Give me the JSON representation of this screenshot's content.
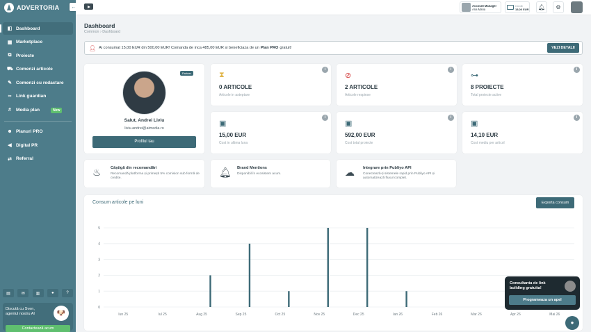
{
  "brand": {
    "name": "ADVERTORIA"
  },
  "sidebar": {
    "collapse_icon": "arrow-left-icon",
    "items": [
      {
        "label": "Dashboard",
        "icon": "dashboard-icon",
        "active": true
      },
      {
        "label": "Marketplace",
        "icon": "store-icon"
      },
      {
        "label": "Proiecte",
        "icon": "projects-icon"
      },
      {
        "label": "Comenzi articole",
        "icon": "cart-icon"
      },
      {
        "label": "Comenzi cu redactare",
        "icon": "edit-cart-icon"
      },
      {
        "label": "Link guardian",
        "icon": "link-icon"
      },
      {
        "label": "Media plan",
        "icon": "hash-icon",
        "badge": "New"
      },
      {
        "label": "Planuri PRO",
        "icon": "users-icon"
      },
      {
        "label": "Digital PR",
        "icon": "megaphone-icon"
      },
      {
        "label": "Referral",
        "icon": "handshake-icon"
      }
    ],
    "assistant": {
      "text": "Discută cu Sven, agentul nostru AI",
      "button": "Contactează acum"
    }
  },
  "topbar": {
    "manager_title": "Account Manager",
    "manager_name": "Ana Maria",
    "credit_label": "Credit",
    "credit_value": "15,00 EUR"
  },
  "page": {
    "title": "Dashboard",
    "breadcrumb": "Common  ›  Dashboard"
  },
  "alert": {
    "pre": "Ai consumat 15,00 EUR din 500,00 EUR! Comanda de inca 485,00 EUR si beneficiaza de un",
    "bold": "Plan PRO",
    "post": "gratuit!",
    "button": "VEZI DETALII"
  },
  "profile": {
    "badge": "Partner",
    "greeting": "Salut, Andrei Liviu",
    "email": "liviu.andrei@aimedia.ro",
    "button": "Profilul tau"
  },
  "stats": [
    {
      "icon": "hourglass-icon",
      "value": "0 ARTICOLE",
      "label": "Articole in asteptare",
      "color": "#e0b54b"
    },
    {
      "icon": "ban-icon",
      "value": "2 ARTICOLE",
      "label": "Articole respinse",
      "color": "#d33a3a"
    },
    {
      "icon": "project-diagram-icon",
      "value": "8 PROIECTE",
      "label": "Total proiecte active",
      "color": "#3d6a77"
    },
    {
      "icon": "money-icon",
      "value": "15,00 EUR",
      "label": "Cost in ultima luna",
      "color": "#3d6a77"
    },
    {
      "icon": "money-icon",
      "value": "592,00 EUR",
      "label": "Cost total proiecte",
      "color": "#3d6a77"
    },
    {
      "icon": "money-icon",
      "value": "14,10 EUR",
      "label": "Cost mediu per articol",
      "color": "#3d6a77"
    }
  ],
  "features": [
    {
      "icon": "piggy-bank-icon",
      "title": "Câștigă din recomandări",
      "desc": "Recomandă platforma și primești 5% comision sub formă de credite."
    },
    {
      "icon": "bell-icon",
      "title": "Brand Mentions",
      "desc": "Disponibil în ecosistem acum."
    },
    {
      "icon": "api-cloud-icon",
      "title": "Integrare prin Publiyo API",
      "desc": "Conectează-ți sistemele rapid prin Publiyo API și automatizează fluxul complet."
    }
  ],
  "chart_card": {
    "title": "Consum articole pe luni",
    "export_button": "Exporta consum"
  },
  "chart_data": {
    "type": "bar",
    "categories": [
      "Iun 25",
      "Iul 25",
      "Aug 25",
      "Sep 25",
      "Oct 25",
      "Nov 25",
      "Dec 25",
      "Ian 26",
      "Feb 26",
      "Mar 26",
      "Apr 26",
      "Mai 26"
    ],
    "values": [
      0,
      0,
      2,
      4,
      1,
      5,
      5,
      1,
      0,
      0,
      1,
      0
    ],
    "title": "Consum articole pe luni",
    "xlabel": "",
    "ylabel": "",
    "ylim": [
      0,
      5
    ],
    "yticks": [
      0,
      1,
      2,
      3,
      4,
      5
    ],
    "grid": true,
    "color": "#3d6a77"
  },
  "promo": {
    "text": "Consultanta de link building gratuita!",
    "button": "Programeaza un apel"
  }
}
